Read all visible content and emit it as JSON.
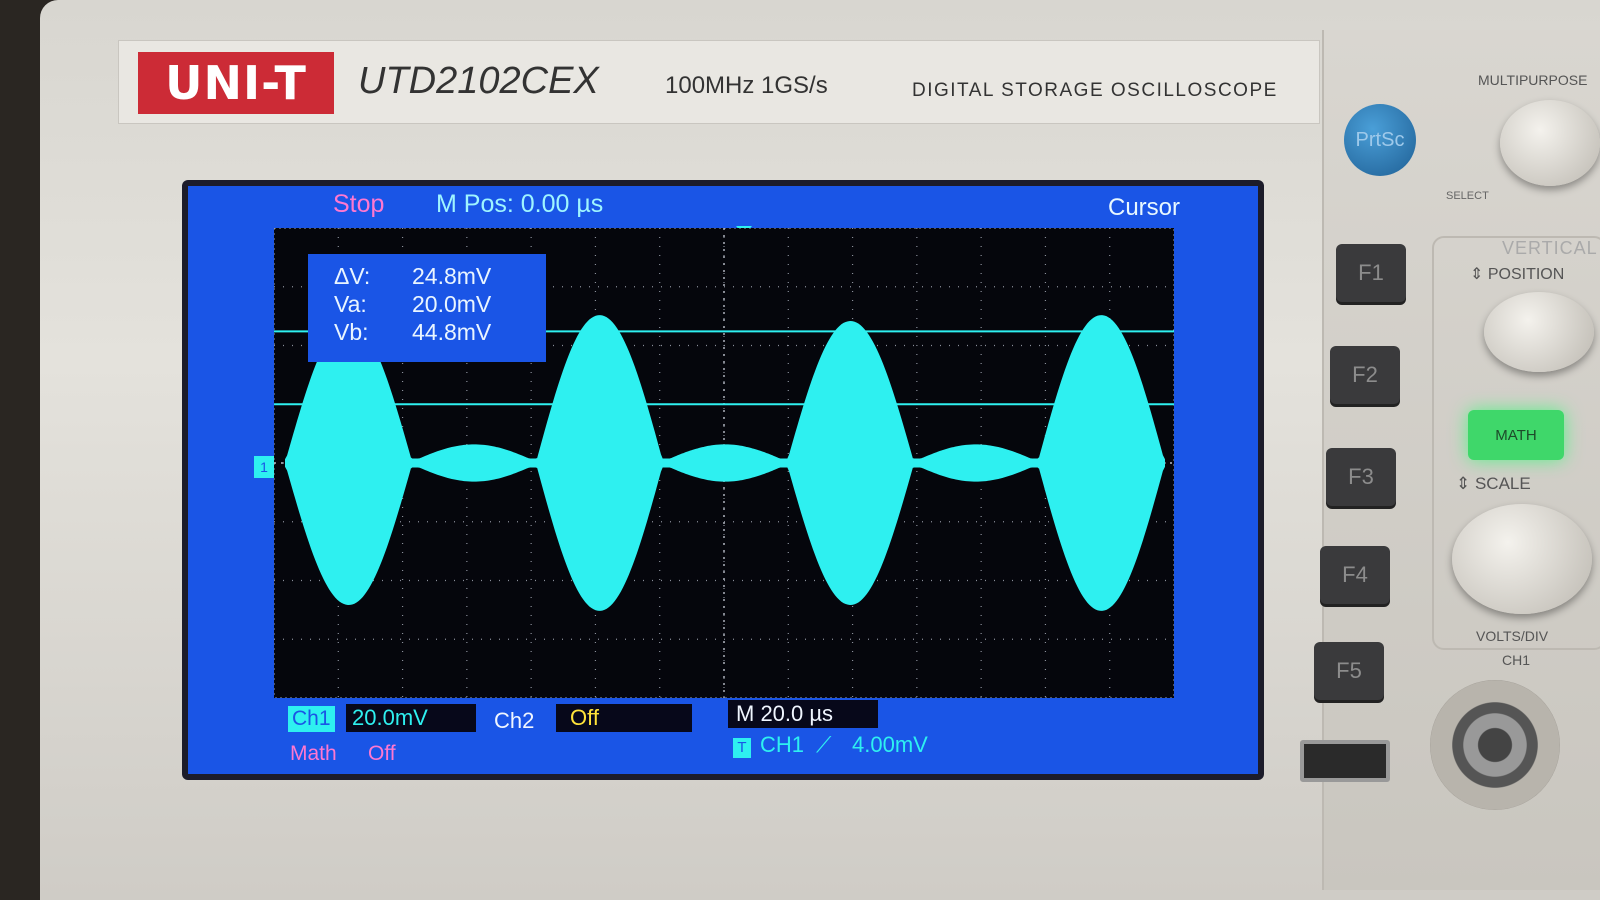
{
  "device": {
    "brand": "UNI-T",
    "model": "UTD2102CEX",
    "spec": "100MHz  1GS/s",
    "type": "DIGITAL STORAGE OSCILLOSCOPE"
  },
  "screen": {
    "run_state": "Stop",
    "m_pos": "M Pos: 0.00 µs",
    "menu_title": "Cursor",
    "cursors": {
      "delta_label": "ΔV:",
      "delta_value": "24.8mV",
      "va_label": "Va:",
      "va_value": "20.0mV",
      "vb_label": "Vb:",
      "vb_value": "44.8mV"
    },
    "ch1_marker": "1",
    "ch1_label": "Ch1",
    "ch1_scale": "20.0mV",
    "ch2_label": "Ch2",
    "ch2_state": "Off",
    "math_label": "Math",
    "math_state": "Off",
    "timebase": "M 20.0 µs",
    "trigger": {
      "mode_icon": "T",
      "source": "CH1",
      "edge_icon": "rising-edge-icon",
      "edge_glyph": "⟋",
      "level": "4.00mV"
    },
    "colors": {
      "background": "#1a55e6",
      "grid_bg": "#05060c",
      "trace": "#2ef0f0",
      "stop_text": "#ff78d0",
      "ch2_value": "#ffe33a"
    },
    "waveform": {
      "description": "amplitude-modulated signal (beat envelope)",
      "envelope_peaks_div": [
        2.4,
        0.3,
        2.5,
        0.3,
        2.4,
        0.3,
        2.5
      ],
      "cursor_a_div": 1.0,
      "cursor_b_div": 2.24
    }
  },
  "panel": {
    "prtsc": "PrtSc",
    "f_keys": [
      "F1",
      "F2",
      "F3",
      "F4",
      "F5"
    ],
    "multipurpose": "MULTIPURPOSE",
    "select": "SELECT",
    "vertical": "VERTICAL",
    "position": "⇕ POSITION",
    "math_button": "MATH",
    "scale": "⇕ SCALE",
    "volts_div": "VOLTS/DIV",
    "ch1_input": "CH1"
  }
}
